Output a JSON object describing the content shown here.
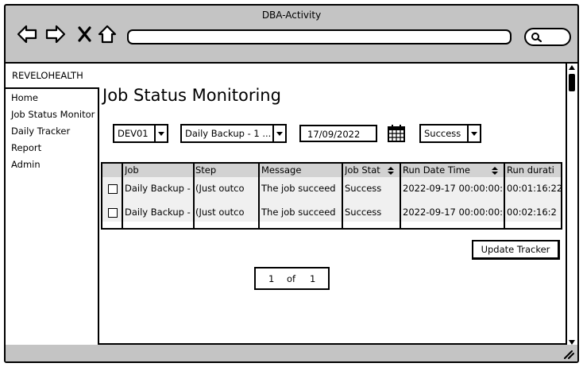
{
  "window": {
    "title": "DBA-Activity"
  },
  "nav_icons": [
    "back-arrow-icon",
    "forward-arrow-icon",
    "close-icon",
    "home-icon"
  ],
  "brand": "REVELOHEALTH",
  "sidebar": {
    "items": [
      {
        "label": "Home"
      },
      {
        "label": "Job Status Monitor"
      },
      {
        "label": "Daily Tracker"
      },
      {
        "label": "Report"
      },
      {
        "label": "Admin"
      }
    ]
  },
  "page_title": "Job Status Monitoring",
  "filters": {
    "server": "DEV01",
    "job": "Daily Backup - 1 ...",
    "date": "17/09/2022",
    "status": "Success"
  },
  "table": {
    "columns": [
      "Job",
      "Step",
      "Message",
      "Job Stat",
      "Run Date Time",
      "Run durati"
    ],
    "rows": [
      {
        "job": "Daily Backup -",
        "step": "(Just outco",
        "message": "The job succeed",
        "status": "Success",
        "run_date": "2022-09-17 00:00:00:",
        "duration": "00:01:16:22"
      },
      {
        "job": "Daily Backup -",
        "step": "(Just outco",
        "message": "The job succeed",
        "status": "Success",
        "run_date": "2022-09-17 00:00:00:",
        "duration": "00:02:16:2"
      }
    ]
  },
  "update_button": "Update Tracker",
  "pagination": {
    "current": "1",
    "of_label": "of",
    "total": "1"
  }
}
